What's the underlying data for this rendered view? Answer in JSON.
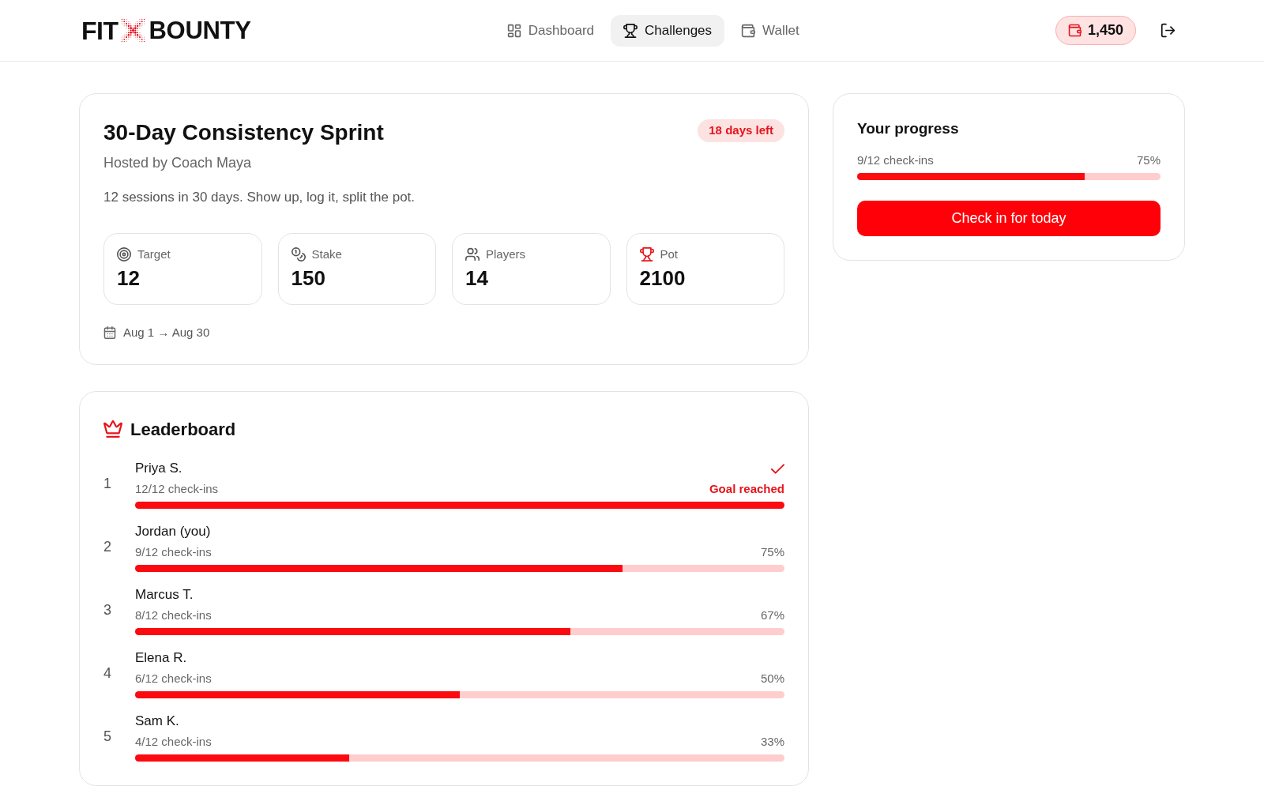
{
  "header": {
    "logo": {
      "text_before": "FIT",
      "text_after": "BOUNTY"
    },
    "nav_tabs": [
      {
        "label": "Dashboard",
        "selected": false
      },
      {
        "label": "Challenges",
        "selected": true
      },
      {
        "label": "Wallet",
        "selected": false
      }
    ],
    "balance": "1,450"
  },
  "challenge": {
    "title": "30-Day Consistency Sprint",
    "badge": "18 days left",
    "host": "Hosted by Coach Maya",
    "description": "12 sessions in 30 days. Show up, log it, split the pot.",
    "stats": [
      {
        "label": "Target",
        "value": "12"
      },
      {
        "label": "Stake",
        "value": "150"
      },
      {
        "label": "Players",
        "value": "14"
      },
      {
        "label": "Pot",
        "value": "2100"
      }
    ],
    "dates": "Aug 1 → Aug 30"
  },
  "progress": {
    "title": "Your progress",
    "checkins": "9/12 check-ins",
    "percent": "75%",
    "level": 0.75,
    "button": "Check in for today"
  },
  "leaderboard": {
    "title": "Leaderboard",
    "rows": [
      {
        "rank": "1",
        "name": "Priya S.",
        "checkins": "12/12 check-ins",
        "progress_label": "Goal reached",
        "goal_reached": true,
        "level": 1
      },
      {
        "rank": "2",
        "name": "Jordan (you)",
        "checkins": "9/12 check-ins",
        "progress_label": "75%",
        "goal_reached": false,
        "level": 0.75
      },
      {
        "rank": "3",
        "name": "Marcus T.",
        "checkins": "8/12 check-ins",
        "progress_label": "67%",
        "goal_reached": false,
        "level": 0.67
      },
      {
        "rank": "4",
        "name": "Elena R.",
        "checkins": "6/12 check-ins",
        "progress_label": "50%",
        "goal_reached": false,
        "level": 0.5
      },
      {
        "rank": "5",
        "name": "Sam K.",
        "checkins": "4/12 check-ins",
        "progress_label": "33%",
        "goal_reached": false,
        "level": 0.33
      }
    ]
  }
}
